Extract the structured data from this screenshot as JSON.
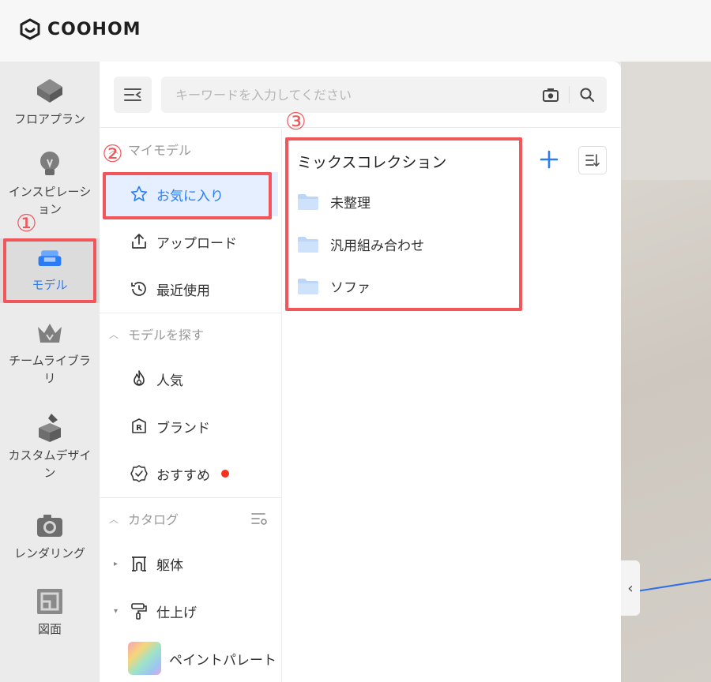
{
  "brand": {
    "name": "COOHOM"
  },
  "rail": {
    "items": [
      {
        "label": "フロアプラン",
        "icon": "floorplan-icon"
      },
      {
        "label": "インスピレーション",
        "icon": "lightbulb-icon"
      },
      {
        "label": "モデル",
        "icon": "sofa-icon",
        "active": true
      },
      {
        "label": "チームライブラリ",
        "icon": "crown-icon"
      },
      {
        "label": "カスタムデザイン",
        "icon": "custom-design-icon"
      },
      {
        "label": "レンダリング",
        "icon": "camera-icon"
      },
      {
        "label": "図面",
        "icon": "drawing-icon"
      }
    ]
  },
  "search": {
    "placeholder": "キーワードを入力してください"
  },
  "nav": {
    "my_models": {
      "header": "マイモデル",
      "items": [
        {
          "label": "お気に入り",
          "icon": "star-icon"
        },
        {
          "label": "アップロード",
          "icon": "upload-icon"
        },
        {
          "label": "最近使用",
          "icon": "history-icon"
        }
      ]
    },
    "find_models": {
      "header": "モデルを探す",
      "items": [
        {
          "label": "人気",
          "icon": "fire-icon"
        },
        {
          "label": "ブランド",
          "icon": "brand-r-icon"
        },
        {
          "label": "おすすめ",
          "icon": "recommend-badge-icon"
        }
      ]
    },
    "catalog": {
      "header": "カタログ",
      "items": [
        {
          "label": "躯体",
          "icon": "structure-icon"
        },
        {
          "label": "仕上げ",
          "icon": "paint-roller-icon"
        },
        {
          "label": "ペイントパレート",
          "icon": "paint-palette-thumb"
        }
      ]
    }
  },
  "collection": {
    "title": "ミックスコレクション",
    "folders": [
      "未整理",
      "汎用組み合わせ",
      "ソファ"
    ]
  },
  "annotations": [
    "①",
    "②",
    "③"
  ],
  "colors": {
    "accent": "#2a7cf6",
    "highlight": "#f0565a",
    "dot": "#f5321d"
  }
}
